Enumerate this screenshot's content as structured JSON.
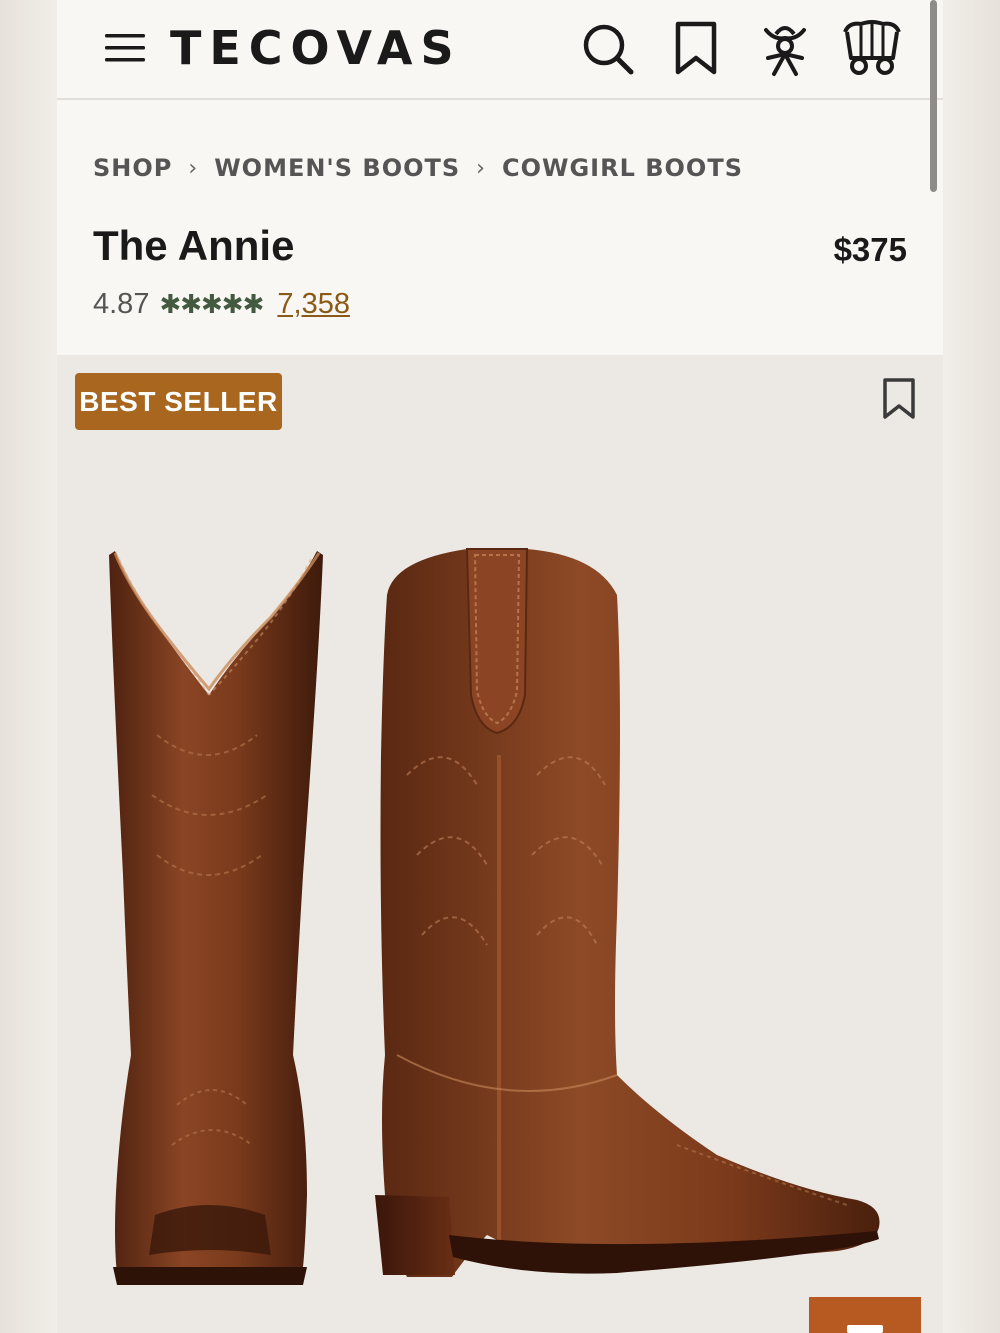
{
  "header": {
    "logo": "TECOVAS",
    "icons": [
      "menu-icon",
      "search-icon",
      "bookmark-icon",
      "cowboy-account-icon",
      "wagon-cart-icon"
    ]
  },
  "breadcrumb": {
    "items": [
      "SHOP",
      "WOMEN'S BOOTS",
      "COWGIRL BOOTS"
    ],
    "separator": "›"
  },
  "product": {
    "title": "The Annie",
    "price": "$375",
    "rating": "4.87",
    "stars": "✱✱✱✱✱",
    "review_count": "7,358"
  },
  "image_area": {
    "badge": "BEST SELLER"
  },
  "colors": {
    "brand_badge": "#a8661f",
    "star_green": "#445a40",
    "link_brown": "#8a5a16",
    "boot_leather": "#7a3a1c",
    "fab_orange": "#b65a22"
  }
}
